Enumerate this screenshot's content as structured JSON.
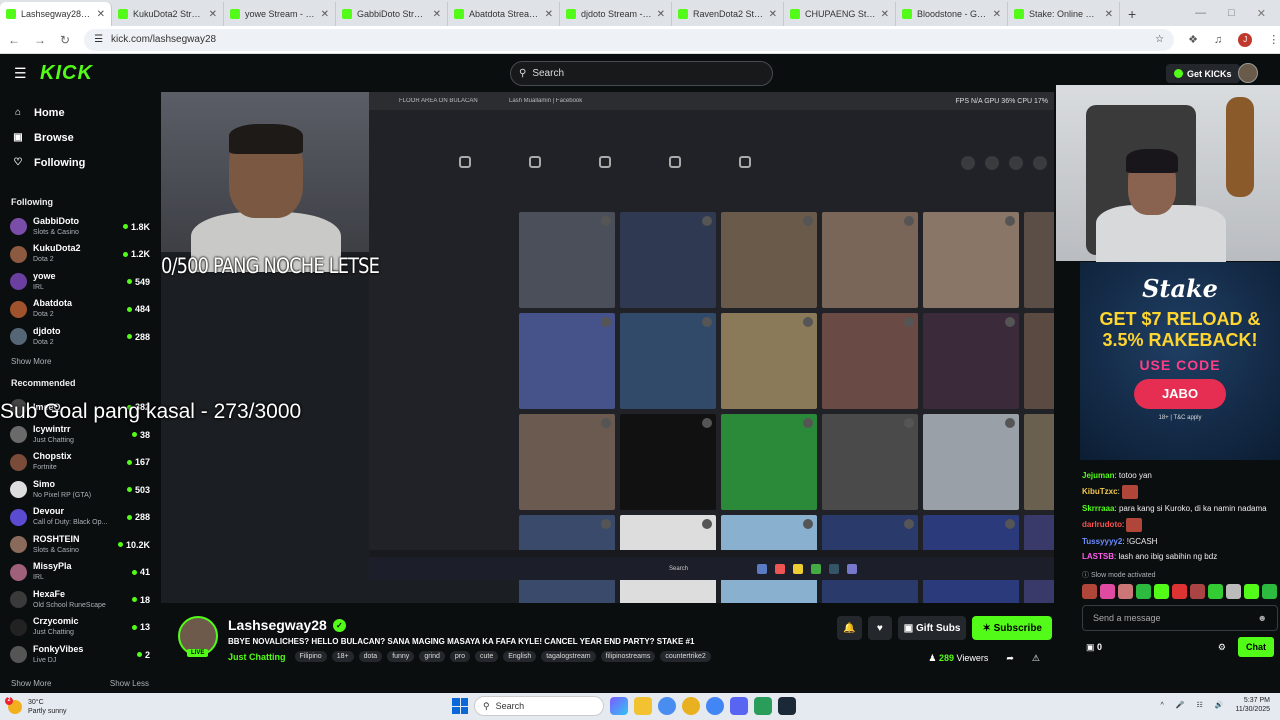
{
  "browser": {
    "tabs": [
      {
        "title": "Lashsegway28 Stream",
        "active": true
      },
      {
        "title": "KukuDota2 Stream"
      },
      {
        "title": "yowe Stream - Watc"
      },
      {
        "title": "GabbiDoto Stream"
      },
      {
        "title": "Abatdota Stream - V"
      },
      {
        "title": "djdoto Stream - Wa"
      },
      {
        "title": "RavenDota2 Stream"
      },
      {
        "title": "CHUPAENG Stream"
      },
      {
        "title": "Bloodstone - Googl"
      },
      {
        "title": "Stake: Online Casin"
      }
    ],
    "url": "kick.com/lashsegway28",
    "profile_initial": "J"
  },
  "header": {
    "logo": "KICK",
    "search_placeholder": "Search",
    "get_kicks": "Get KICKs"
  },
  "sidebar": {
    "nav": [
      {
        "label": "Home",
        "icon": "home-icon"
      },
      {
        "label": "Browse",
        "icon": "browse-icon"
      },
      {
        "label": "Following",
        "icon": "heart-icon"
      }
    ],
    "following_title": "Following",
    "following": [
      {
        "name": "GabbiDoto",
        "category": "Slots & Casino",
        "viewers": "1.8K",
        "color": "#7a4ea8"
      },
      {
        "name": "KukuDota2",
        "category": "Dota 2",
        "viewers": "1.2K",
        "color": "#8b5a40"
      },
      {
        "name": "yowe",
        "category": "IRL",
        "viewers": "549",
        "color": "#6b3fa0"
      },
      {
        "name": "Abatdota",
        "category": "Dota 2",
        "viewers": "484",
        "color": "#a0522d"
      },
      {
        "name": "djdoto",
        "category": "Dota 2",
        "viewers": "288",
        "color": "#556677"
      }
    ],
    "show_more": "Show More",
    "recommended_title": "Recommended",
    "recommended": [
      {
        "name": "ImeeQ",
        "category": "",
        "viewers": "382",
        "color": "#444"
      },
      {
        "name": "Icywintrr",
        "category": "Just Chatting",
        "viewers": "38",
        "color": "#6a6a6a"
      },
      {
        "name": "Chopstix",
        "category": "Fortnite",
        "viewers": "167",
        "color": "#7b4b3a"
      },
      {
        "name": "Simo",
        "category": "No Pixel RP (GTA)",
        "viewers": "503",
        "color": "#ddd"
      },
      {
        "name": "Devour",
        "category": "Call of Duty: Black Op...",
        "viewers": "288",
        "color": "#5b4bd0"
      },
      {
        "name": "ROSHTEIN",
        "category": "Slots & Casino",
        "viewers": "10.2K",
        "color": "#8a6a5a"
      },
      {
        "name": "MissyPla",
        "category": "IRL",
        "viewers": "41",
        "color": "#a0607a"
      },
      {
        "name": "HexaFe",
        "category": "Old School RuneScape",
        "viewers": "18",
        "color": "#3a3a3a"
      },
      {
        "name": "Crzycomic",
        "category": "Just Chatting",
        "viewers": "13",
        "color": "#222"
      },
      {
        "name": "FonkyVibes",
        "category": "Live DJ",
        "viewers": "2",
        "color": "#555"
      }
    ],
    "footer_more": "Show More",
    "footer_less": "Show Less"
  },
  "video": {
    "overlay_goal1": "0/500 PANG NOCHE LETSE",
    "overlay_goal2": "Sub Goal pang kasal - 273/3000",
    "inner_tabs": [
      "FLOOR AREA ON BULACAN",
      "Lash Muallamin | Facebook"
    ],
    "stats": "FPS N/A   GPU 36%   CPU 17%",
    "search": "Search"
  },
  "stream": {
    "name": "Lashsegway28",
    "live_label": "LIVE",
    "title": "BBYE NOVALICHES? HELLO BULACAN? SANA MAGING MASAYA KA FAFA KYLE! CANCEL YEAR END PARTY? STAKE #1",
    "category": "Just Chatting",
    "tags": [
      "Filipino",
      "18+",
      "dota",
      "funny",
      "grind",
      "pro",
      "cute",
      "English",
      "tagalogstream",
      "filipinostreams",
      "countertrike2"
    ],
    "gift_subs": "Gift Subs",
    "subscribe": "Subscribe",
    "viewers_count": "289",
    "viewers_label": "Viewers"
  },
  "ad": {
    "brand": "Stake",
    "promo_line1": "GET $7 RELOAD &",
    "promo_line2": "3.5% RAKEBACK!",
    "use_code": "USE CODE",
    "code": "JABO",
    "terms": "18+ | T&C apply"
  },
  "chat": {
    "messages": [
      {
        "user": "Jejuman",
        "color": "#53fc18",
        "text": "totoo yan"
      },
      {
        "user": "KibuTzxc",
        "color": "#f2c94c",
        "text": "",
        "emote": true
      },
      {
        "user": "Skrrraaa",
        "color": "#53fc18",
        "text": "para kang si Kuroko, di ka namin nadama"
      },
      {
        "user": "darlrudoto",
        "color": "#ff4d4d",
        "text": "",
        "emote": true
      },
      {
        "user": "Tussyyyy2",
        "color": "#6c8cff",
        "text": "!GCASH"
      },
      {
        "user": "LASTSB",
        "color": "#ff5cf0",
        "text": "lash ano ibig sabihin ng bdz"
      }
    ],
    "slow_mode": "Slow mode activated",
    "input_placeholder": "Send a message",
    "points": "0",
    "chat_button": "Chat"
  },
  "taskbar": {
    "temp": "30°C",
    "weather": "Partly sunny",
    "badge": "2",
    "search": "Search",
    "time": "5:37 PM",
    "date": "11/30/2025"
  }
}
